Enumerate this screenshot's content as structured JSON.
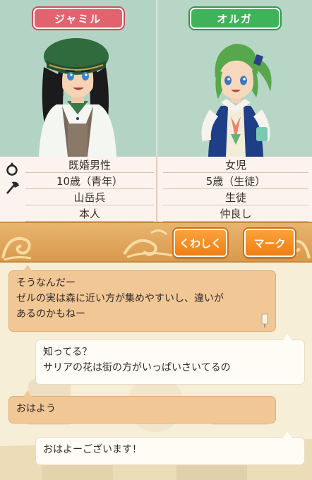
{
  "characters": {
    "left": {
      "name": "ジャミル"
    },
    "right": {
      "name": "オルガ"
    }
  },
  "info": {
    "icons": [
      "ring-icon",
      "axe-icon"
    ],
    "left": [
      "既婚男性",
      "10歳（青年）",
      "山岳兵",
      "本人"
    ],
    "right": [
      "女児",
      "5歳（生徒）",
      "生徒",
      "仲良し"
    ]
  },
  "buttons": {
    "details": "くわしく",
    "mark": "マーク"
  },
  "chat": [
    {
      "style": "tan",
      "lines": [
        "そうなんだー",
        "ゼルの実は森に近い方が集めやすいし、違いが",
        "あるのかもねー"
      ]
    },
    {
      "style": "white",
      "lines": [
        "知ってる？",
        "サリアの花は街の方がいっぱいさいてるの"
      ]
    },
    {
      "style": "tan",
      "lines": [
        "おはよう"
      ]
    },
    {
      "style": "white",
      "lines": [
        "おはよーございます！"
      ]
    }
  ],
  "colors": {
    "left_tag": "#e0636d",
    "right_tag": "#3fb35a",
    "button": "#ef7e12",
    "bubble_tan": "#f2c796",
    "bubble_white": "#fffcf6"
  }
}
